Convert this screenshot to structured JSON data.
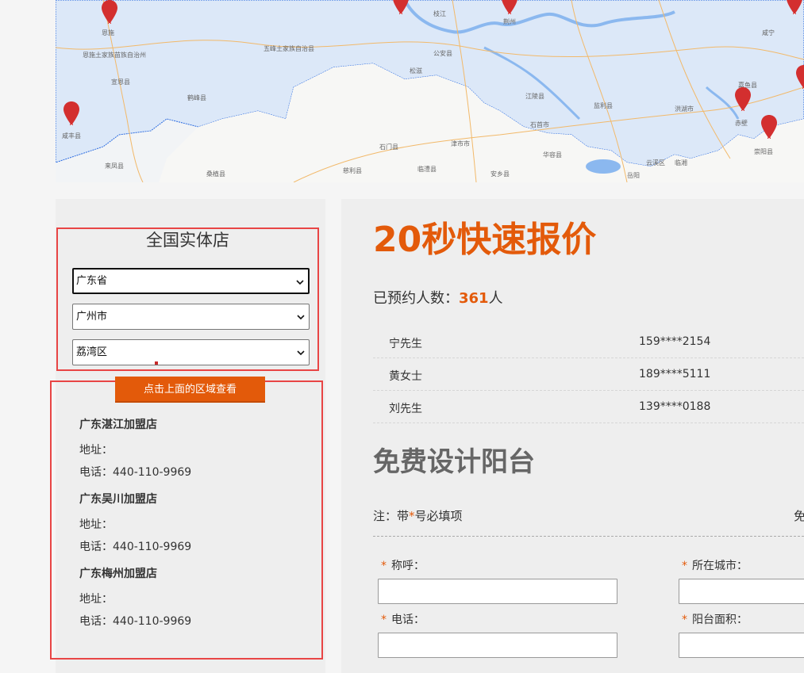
{
  "map": {
    "labels": [
      "恩施",
      "恩施土家族苗族自治州",
      "五峰土家族自治县",
      "宣恩县",
      "鹤峰县",
      "咸丰县",
      "来凤县",
      "桑植县",
      "石门县",
      "慈利县",
      "临澧县",
      "津市市",
      "安乡县",
      "华容县",
      "公安县",
      "石首市",
      "江陵县",
      "监利县",
      "洪湖市",
      "荆州",
      "枝江",
      "松滋",
      "云溪区",
      "岳阳",
      "临湘",
      "赤壁",
      "崇阳县",
      "嘉鱼县",
      "咸宁"
    ]
  },
  "left": {
    "store_title": "全国实体店",
    "province": "广东省",
    "city": "广州市",
    "district": "荔湾区",
    "view_button": "点击上面的区域查看",
    "shops": [
      {
        "name": "广东湛江加盟店",
        "address": "地址：",
        "phone": "电话：440-110-9969"
      },
      {
        "name": "广东吴川加盟店",
        "address": "地址：",
        "phone": "电话：440-110-9969"
      },
      {
        "name": "广东梅州加盟店",
        "address": "地址：",
        "phone": "电话：440-110-9969"
      }
    ]
  },
  "right": {
    "quote_title": "20秒快速报价",
    "booked_prefix": "已预约人数：",
    "booked_count": "361",
    "booked_suffix": "人",
    "bookings": [
      {
        "name": "宁先生",
        "phone": "159****2154"
      },
      {
        "name": "黄女士",
        "phone": "189****5111"
      },
      {
        "name": "刘先生",
        "phone": "139****0188"
      }
    ],
    "design_title": "免费设计阳台",
    "note_prefix": "注：带",
    "note_star": "*",
    "note_suffix": "号必填项",
    "note_right": "免",
    "form": {
      "star": "*",
      "name_label": "称呼：",
      "city_label": "所在城市：",
      "phone_label": "电话：",
      "area_label": "阳台面积："
    }
  },
  "colors": {
    "accent": "#e35a0a",
    "highlight_border": "#e84545",
    "water": "#dce8f8",
    "pin": "#d32f2f"
  },
  "icons": {
    "select_arrow": "chevron-down-icon",
    "map_pin": "map-pin-icon"
  }
}
